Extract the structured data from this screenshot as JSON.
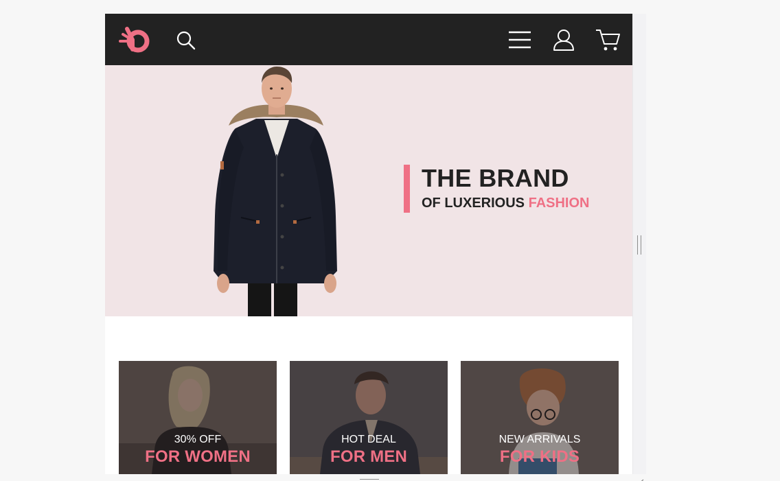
{
  "header": {
    "logo_icon": "brand-logo-icon",
    "search_icon": "search-icon",
    "menu_icon": "hamburger-menu-icon",
    "user_icon": "user-account-icon",
    "cart_icon": "shopping-cart-icon"
  },
  "hero": {
    "title": "THE BRAND",
    "subtitle_prefix": "OF LUXERIOUS",
    "subtitle_accent": "FASHION"
  },
  "categories": [
    {
      "kicker": "30% OFF",
      "heading": "FOR WOMEN"
    },
    {
      "kicker": "HOT DEAL",
      "heading": "FOR MEN"
    },
    {
      "kicker": "NEW ARRIVALS",
      "heading": "FOR KIDS"
    }
  ],
  "colors": {
    "header_bg": "#222222",
    "hero_bg": "#f1e4e6",
    "accent_pink": "#ef7085",
    "text_dark": "#222222"
  }
}
